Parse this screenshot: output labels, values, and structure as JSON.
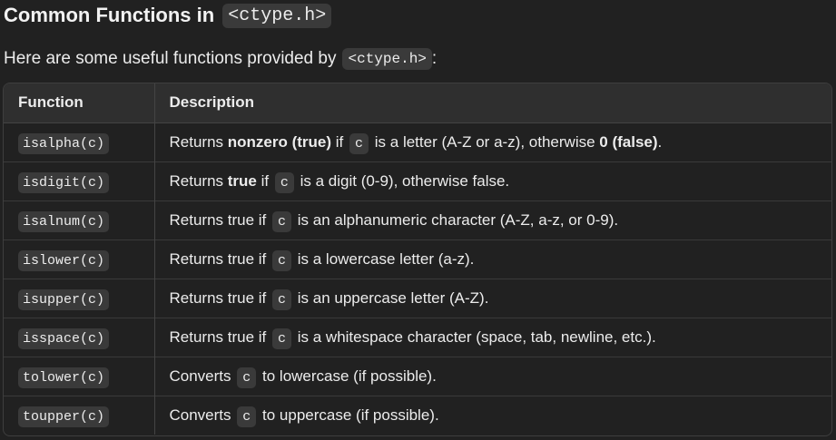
{
  "heading": {
    "text": "Common Functions in",
    "code": "<ctype.h>"
  },
  "intro": {
    "text": "Here are some useful functions provided by",
    "code": "<ctype.h>",
    "suffix": ":"
  },
  "table": {
    "headers": [
      "Function",
      "Description"
    ],
    "param": "c",
    "rows": [
      {
        "fn": "isalpha(c)",
        "d": [
          "Returns",
          "nonzero (true)",
          "if",
          "is a letter (A-Z or a-z), otherwise",
          "0 (false)",
          "."
        ]
      },
      {
        "fn": "isdigit(c)",
        "d": [
          "Returns",
          "true",
          "if",
          "is a digit (0-9), otherwise false."
        ]
      },
      {
        "fn": "isalnum(c)",
        "d": [
          "Returns true if",
          "is an alphanumeric character (A-Z, a-z, or 0-9)."
        ]
      },
      {
        "fn": "islower(c)",
        "d": [
          "Returns true if",
          "is a lowercase letter (a-z)."
        ]
      },
      {
        "fn": "isupper(c)",
        "d": [
          "Returns true if",
          "is an uppercase letter (A-Z)."
        ]
      },
      {
        "fn": "isspace(c)",
        "d": [
          "Returns true if",
          "is a whitespace character (space, tab, newline, etc.)."
        ]
      },
      {
        "fn": "tolower(c)",
        "d": [
          "Converts",
          "to lowercase (if possible)."
        ]
      },
      {
        "fn": "toupper(c)",
        "d": [
          "Converts",
          "to uppercase (if possible)."
        ]
      }
    ]
  }
}
